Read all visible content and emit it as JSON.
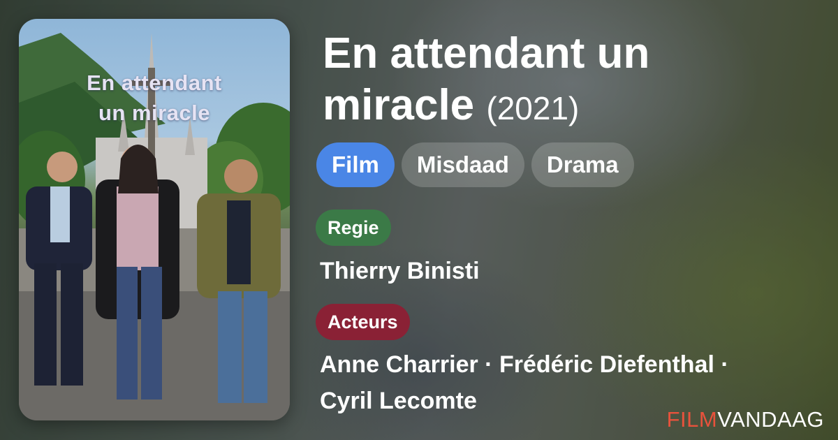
{
  "movie": {
    "title": "En attendant un miracle",
    "year": "(2021)"
  },
  "poster": {
    "title_line1": "En attendant",
    "title_line2": "un miracle"
  },
  "genres": [
    "Film",
    "Misdaad",
    "Drama"
  ],
  "regie": {
    "label": "Regie",
    "name": "Thierry Binisti"
  },
  "acteurs": {
    "label": "Acteurs",
    "line1": "Anne Charrier · Frédéric Diefenthal ·",
    "line2": "Cyril Lecomte"
  },
  "brand": {
    "part1": "FILM",
    "part2": "VANDAAG"
  },
  "colors": {
    "genre_active": "#4a86e6",
    "regie_badge": "#3b7a47",
    "acteurs_badge": "#8a2135",
    "brand_accent": "#e8523c"
  }
}
